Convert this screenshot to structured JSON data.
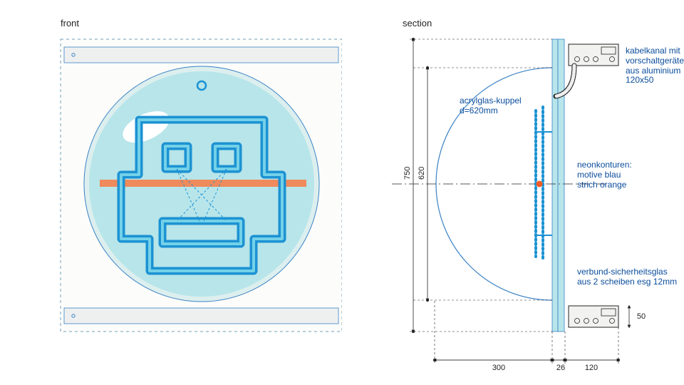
{
  "views": {
    "front": {
      "title": "front"
    },
    "section": {
      "title": "section"
    }
  },
  "labels": {
    "acryl_dome": {
      "l1": "acrylglas-kuppel",
      "l2": "d=620mm"
    },
    "neon": {
      "l1": "neonkonturen:",
      "l2": "motive blau",
      "l3": "strich orange"
    },
    "kabel": {
      "l1": "kabelkanal mit",
      "l2": "vorschaltgeräten",
      "l3": "aus aluminium 120x50"
    },
    "vsg": {
      "l1": "verbund-sicherheitsglas",
      "l2": "aus 2 scheiben esg 12mm"
    }
  },
  "dimensions": {
    "v_outer": "750",
    "v_inner": "620",
    "h_300": "300",
    "h_26": "26",
    "h_120": "120",
    "h_50": "50"
  },
  "colors": {
    "blue_line": "#1c92d3",
    "blue_fill": "#aee1ec",
    "dome_fill": "#eaf4f6",
    "outline": "#3b82c6",
    "orange": "#ef8a5c",
    "guide": "#6fa1b9",
    "steel": "#a8a8a8",
    "steel_light": "#d8d8d8"
  }
}
